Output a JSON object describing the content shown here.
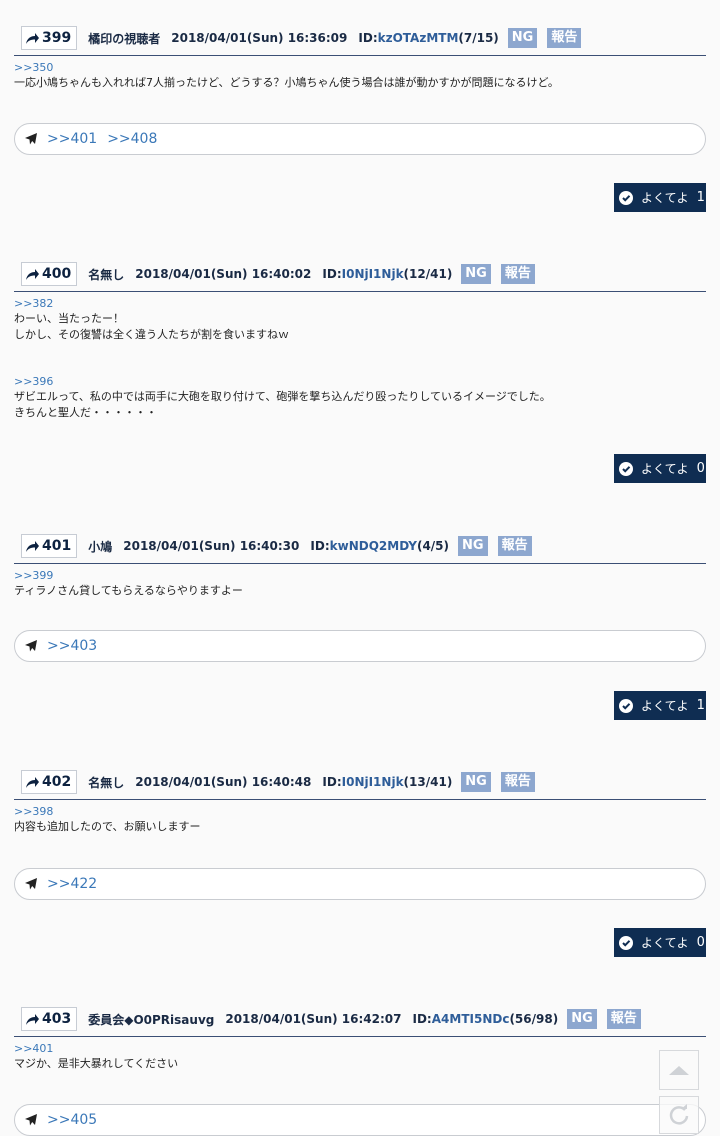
{
  "posts": [
    {
      "num": "399",
      "name": "橘印の視聴者",
      "date": "2018/04/01(Sun) 16:36:09",
      "id_label": "ID:",
      "id": "kzOTAzMTM",
      "count": "(7/15)",
      "ng": "NG",
      "report": "報告",
      "blocks": [
        {
          "anchor": ">>350",
          "lines": [
            "一応小鳩ちゃんも入れれば7人揃ったけど、どうする？小鳩ちゃん使う場合は誰が動かすかが問題になるけど。"
          ]
        }
      ],
      "replies": [
        ">>401",
        ">>408"
      ],
      "like_label": "よくてよ",
      "like_count": "1"
    },
    {
      "num": "400",
      "name": "名無し",
      "date": "2018/04/01(Sun) 16:40:02",
      "id_label": "ID:",
      "id": "I0NjI1Njk",
      "count": "(12/41)",
      "ng": "NG",
      "report": "報告",
      "blocks": [
        {
          "anchor": ">>382",
          "lines": [
            "わーい、当たったー！",
            "しかし、その復讐は全く違う人たちが割を食いますねｗ"
          ]
        },
        {
          "anchor": ">>396",
          "lines": [
            "ザビエルって、私の中では両手に大砲を取り付けて、砲弾を撃ち込んだり殴ったりしているイメージでした。",
            "きちんと聖人だ・・・・・・"
          ]
        }
      ],
      "replies": [],
      "like_label": "よくてよ",
      "like_count": "0"
    },
    {
      "num": "401",
      "name": "小鳩",
      "date": "2018/04/01(Sun) 16:40:30",
      "id_label": "ID:",
      "id": "kwNDQ2MDY",
      "count": "(4/5)",
      "ng": "NG",
      "report": "報告",
      "blocks": [
        {
          "anchor": ">>399",
          "lines": [
            "ティラノさん貸してもらえるならやりますよー"
          ]
        }
      ],
      "replies": [
        ">>403"
      ],
      "like_label": "よくてよ",
      "like_count": "1"
    },
    {
      "num": "402",
      "name": "名無し",
      "date": "2018/04/01(Sun) 16:40:48",
      "id_label": "ID:",
      "id": "I0NjI1Njk",
      "count": "(13/41)",
      "ng": "NG",
      "report": "報告",
      "blocks": [
        {
          "anchor": ">>398",
          "lines": [
            "内容も追加したので、お願いしますー"
          ]
        }
      ],
      "replies": [
        ">>422"
      ],
      "like_label": "よくてよ",
      "like_count": "0"
    },
    {
      "num": "403",
      "name": "委員会◆O0PRisauvg",
      "date": "2018/04/01(Sun) 16:42:07",
      "id_label": "ID:",
      "id": "A4MTI5NDc",
      "count": "(56/98)",
      "ng": "NG",
      "report": "報告",
      "blocks": [
        {
          "anchor": ">>401",
          "lines": [
            "マジか、是非大暴れしてください"
          ]
        }
      ],
      "replies": [
        ">>405"
      ]
    }
  ],
  "icons": {
    "post_link": "share-arrow-icon",
    "reply": "paper-plane-icon",
    "like": "check-circle-icon",
    "scroll_top": "chevron-up-icon",
    "reload": "reload-icon"
  },
  "colors": {
    "navy": "#0f2d52",
    "tag": "#8da7cf",
    "link": "#3b78b8"
  }
}
